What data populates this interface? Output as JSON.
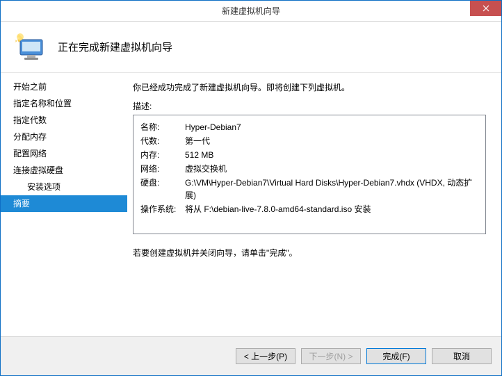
{
  "window": {
    "title": "新建虚拟机向导"
  },
  "header": {
    "title": "正在完成新建虚拟机向导"
  },
  "sidebar": {
    "items": [
      {
        "label": "开始之前",
        "indent": false
      },
      {
        "label": "指定名称和位置",
        "indent": false
      },
      {
        "label": "指定代数",
        "indent": false
      },
      {
        "label": "分配内存",
        "indent": false
      },
      {
        "label": "配置网络",
        "indent": false
      },
      {
        "label": "连接虚拟硬盘",
        "indent": false
      },
      {
        "label": "安装选项",
        "indent": true
      },
      {
        "label": "摘要",
        "indent": false,
        "selected": true
      }
    ]
  },
  "main": {
    "intro": "你已经成功完成了新建虚拟机向导。即将创建下列虚拟机。",
    "desc_label": "描述:",
    "desc": {
      "rows": [
        {
          "key": "名称:",
          "val": "Hyper-Debian7"
        },
        {
          "key": "代数:",
          "val": "第一代"
        },
        {
          "key": "内存:",
          "val": "512 MB"
        },
        {
          "key": "网络:",
          "val": "虚拟交换机"
        },
        {
          "key": "硬盘:",
          "val": "G:\\VM\\Hyper-Debian7\\Virtual Hard Disks\\Hyper-Debian7.vhdx (VHDX, 动态扩展)"
        },
        {
          "key": "操作系统:",
          "val": "将从 F:\\debian-live-7.8.0-amd64-standard.iso 安装"
        }
      ]
    },
    "footer_note": "若要创建虚拟机并关闭向导，请单击\"完成\"。"
  },
  "buttons": {
    "prev": "< 上一步(P)",
    "next": "下一步(N) >",
    "finish": "完成(F)",
    "cancel": "取消"
  }
}
